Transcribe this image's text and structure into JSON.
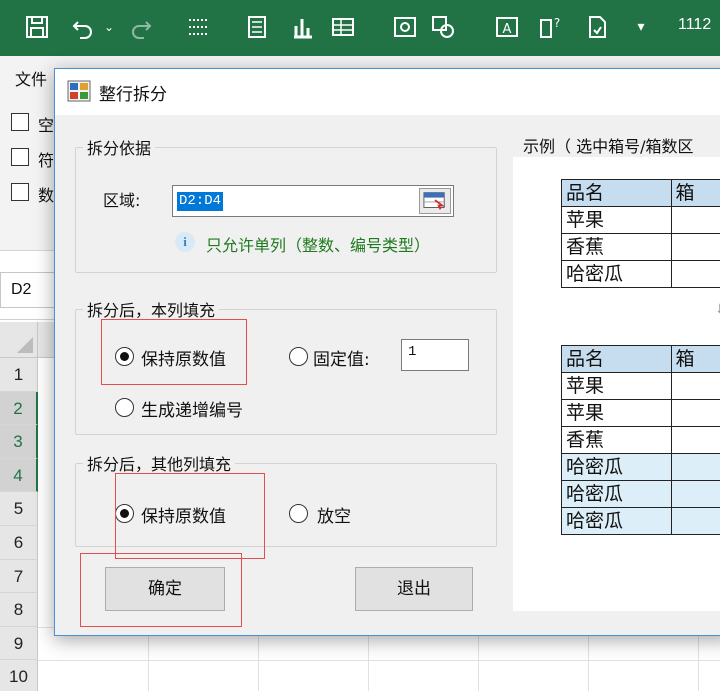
{
  "excel": {
    "title_text": "1112",
    "file_menu": "文件",
    "ribbon_checks": [
      "空",
      "符",
      "数"
    ],
    "name_box": "D2",
    "row_numbers": [
      "1",
      "2",
      "3",
      "4",
      "5",
      "6",
      "7",
      "8",
      "9",
      "10"
    ]
  },
  "dialog": {
    "title": "整行拆分",
    "split_basis": {
      "group_title": "拆分依据",
      "region_label": "区域:",
      "region_value": "D2:D4",
      "hint": "只允许单列（整数、编号类型）"
    },
    "this_column_fill": {
      "group_title": "拆分后，本列填充",
      "keep_original": "保持原数值",
      "fixed_value_label": "固定值:",
      "fixed_value": "1",
      "generate_increment": "生成递增编号",
      "selected": "keep_original"
    },
    "other_columns_fill": {
      "group_title": "拆分后，其他列填充",
      "keep_original": "保持原数值",
      "leave_empty": "放空",
      "selected": "keep_original"
    },
    "ok_button": "确定",
    "exit_button": "退出",
    "example": {
      "title": "示例（ 选中箱号/箱数区",
      "before": {
        "header": [
          "品名",
          "箱"
        ],
        "rows": [
          "苹果",
          "香蕉",
          "哈密瓜"
        ]
      },
      "arrow": "⬇",
      "after": {
        "header": [
          "品名",
          "箱"
        ],
        "rows": [
          "苹果",
          "苹果",
          "香蕉",
          "哈密瓜",
          "哈密瓜",
          "哈密瓜"
        ]
      }
    }
  },
  "colors": {
    "excel_green": "#217346",
    "highlight_red": "#e05050",
    "hint_green": "#1f7a1f",
    "table_header_blue": "#c6dcef",
    "table_highlight_blue": "#dceef7"
  }
}
